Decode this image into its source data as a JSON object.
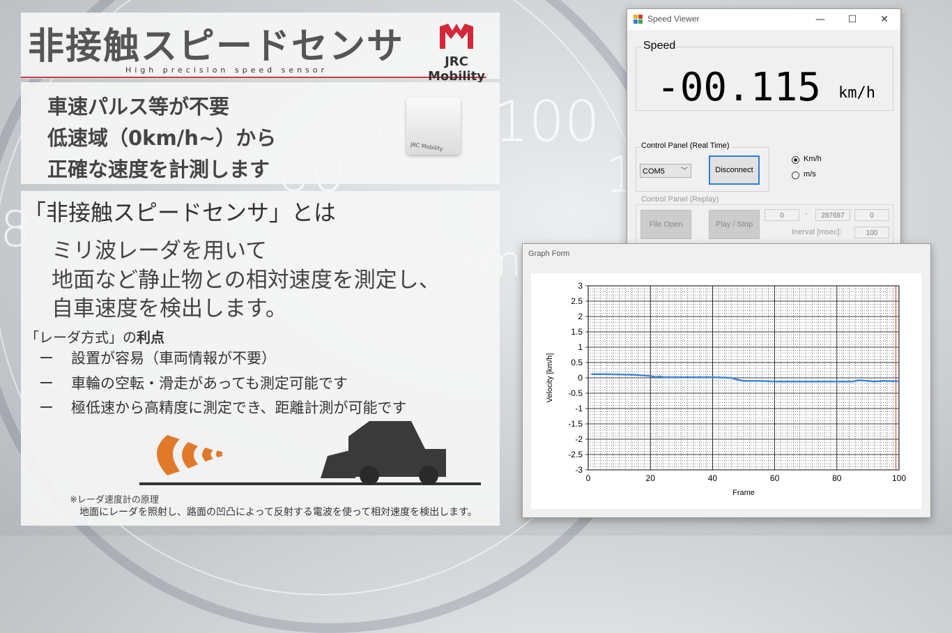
{
  "slide": {
    "title": "非接触スピードセンサ",
    "subtitle": "High precision speed sensor",
    "logo_text": "JRC Mobility",
    "features": [
      "車速パルス等が不要",
      "低速域（0km/h~）から",
      "正確な速度を計測します"
    ],
    "device_label": "JRC Mobility",
    "desc_heading": "「非接触スピードセンサ」とは",
    "desc_lines": [
      "ミリ波レーダを用いて",
      "地面など静止物との相対速度を測定し、",
      "自車速度を検出します。"
    ],
    "advantages_title_prefix": "「レーダ方式」の",
    "advantages_title_bold": "利点",
    "advantages": [
      {
        "dash": "ー",
        "text": "設置が容易（車両情報が不要）"
      },
      {
        "dash": "ー",
        "text": "車輪の空転・滑走があっても測定可能です"
      },
      {
        "dash": "ー",
        "text": "極低速から高精度に測定でき、距離計測が可能です"
      }
    ],
    "note_title": "※レーダ速度計の原理",
    "note_body": "地面にレーダを照射し、路面の凹凸によって反射する電波を使って相対速度を検出します。",
    "colors": {
      "accent_red": "#c8323c",
      "radar_orange": "#e07a2a"
    }
  },
  "background": {
    "dial_numbers": [
      "80",
      "100",
      "60",
      "12",
      "km/h",
      "8"
    ]
  },
  "speed_viewer": {
    "title": "Speed Viewer",
    "controls": {
      "minimize": "—",
      "maximize": "☐",
      "close": "✕"
    },
    "speed_label": "Speed",
    "speed_value": "-00.115",
    "speed_unit": "km/h",
    "cp_realtime_label": "Control Panel (Real Time)",
    "com_port": "COM5",
    "disconnect_label": "Disconnect",
    "unit_options": [
      {
        "label": "Km/h",
        "selected": true
      },
      {
        "label": "m/s",
        "selected": false
      }
    ],
    "cp_replay_label": "Control Panel (Replay)",
    "file_open_label": "File Open",
    "play_stop_label": "Play / Stop",
    "range_start": "0",
    "range_sep": "-",
    "range_end": "287687",
    "range_current": "0",
    "interval_label": "Inerval [msec]:",
    "interval_value": "100"
  },
  "graph_form": {
    "title": "Graph Form",
    "colors": {
      "line": "#3d85d6",
      "cursor": "#d03030"
    }
  },
  "chart_data": {
    "type": "line",
    "title": "",
    "xlabel": "Frame",
    "ylabel": "Velocity [km/h]",
    "xlim": [
      0,
      100
    ],
    "ylim": [
      -3,
      3
    ],
    "xticks": [
      0,
      20,
      40,
      60,
      80,
      100
    ],
    "yticks": [
      3,
      2.5,
      2,
      1.5,
      1,
      0.5,
      0,
      -0.5,
      -1,
      -1.5,
      -2,
      -2.5,
      -3
    ],
    "cursor_x": 99,
    "grid": true,
    "series": [
      {
        "x": [
          1,
          5,
          10,
          15,
          20,
          22,
          23,
          24,
          30,
          40,
          46,
          48,
          50,
          55,
          60,
          65,
          70,
          75,
          80,
          85,
          87,
          90,
          92,
          95,
          100
        ],
        "values": [
          0.12,
          0.12,
          0.11,
          0.1,
          0.06,
          0.02,
          0.05,
          0.02,
          0.02,
          0.02,
          0.0,
          -0.06,
          -0.1,
          -0.1,
          -0.12,
          -0.12,
          -0.12,
          -0.12,
          -0.12,
          -0.12,
          -0.08,
          -0.1,
          -0.12,
          -0.1,
          -0.11
        ]
      }
    ]
  }
}
